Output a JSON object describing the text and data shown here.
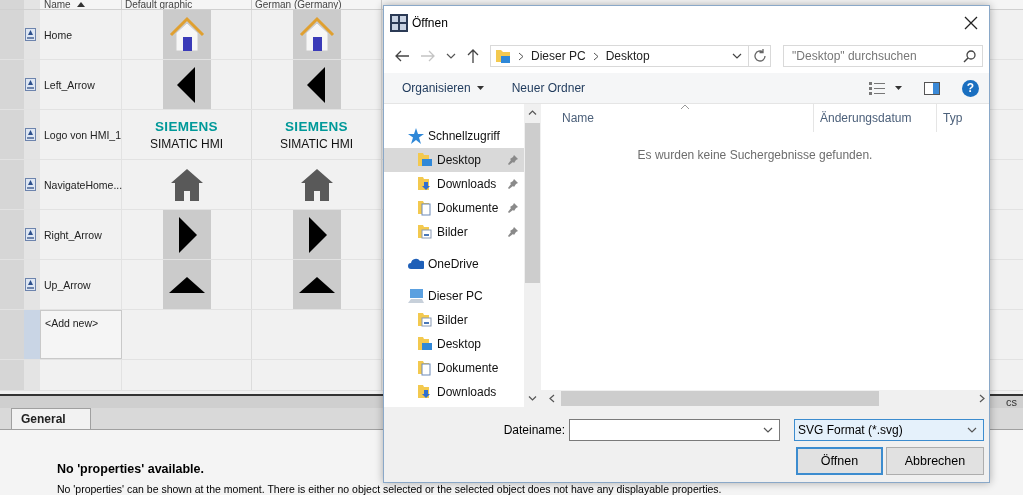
{
  "graphics_table": {
    "columns": [
      {
        "label": "Name",
        "sorted": true
      },
      {
        "label": "Default graphic"
      },
      {
        "label": "German (Germany)"
      }
    ],
    "rows": [
      {
        "cells": [
          {
            "kind": "name",
            "text": "Home"
          },
          {
            "kind": "house"
          },
          {
            "kind": "house"
          }
        ]
      },
      {
        "cells": [
          {
            "kind": "name",
            "text": "Left_Arrow"
          },
          {
            "kind": "arrow_left"
          },
          {
            "kind": "arrow_left"
          }
        ]
      },
      {
        "cells": [
          {
            "kind": "name",
            "text": "Logo von HMI_1"
          },
          {
            "kind": "logo",
            "brand": "SIEMENS",
            "product": "SIMATIC HMI"
          },
          {
            "kind": "logo",
            "brand": "SIEMENS",
            "product": "SIMATIC HMI"
          }
        ]
      },
      {
        "cells": [
          {
            "kind": "name",
            "text": "NavigateHome..."
          },
          {
            "kind": "house_dark"
          },
          {
            "kind": "house_dark"
          }
        ]
      },
      {
        "cells": [
          {
            "kind": "name",
            "text": "Right_Arrow"
          },
          {
            "kind": "arrow_right"
          },
          {
            "kind": "arrow_right"
          }
        ]
      },
      {
        "cells": [
          {
            "kind": "name",
            "text": "Up_Arrow"
          },
          {
            "kind": "arrow_up"
          },
          {
            "kind": "arrow_up"
          }
        ]
      },
      {
        "cells": [
          {
            "kind": "add_new",
            "text": "<Add new>"
          }
        ]
      }
    ]
  },
  "side_tab_fragment": "cs",
  "properties": {
    "tabs": [
      {
        "label": "General",
        "selected": true
      }
    ],
    "heading": "No 'properties' available.",
    "message": "No 'properties' can be shown at the moment. There is either no object selected or the selected object does not have any displayable properties."
  },
  "dialog": {
    "title": "Öffnen",
    "breadcrumb": [
      "Dieser PC",
      "Desktop"
    ],
    "search": {
      "placeholder": "\"Desktop\" durchsuchen"
    },
    "toolbar": [
      {
        "label": "Organisieren",
        "dropdown": true
      },
      {
        "label": "Neuer Ordner",
        "dropdown": false
      }
    ],
    "help": "?",
    "nav": [
      {
        "label": "Schnellzugriff",
        "kind": "star",
        "selected": false,
        "children": [
          {
            "label": "Desktop",
            "kind": "desktop",
            "selected": true,
            "pinned": true
          },
          {
            "label": "Downloads",
            "kind": "downloads",
            "selected": false,
            "pinned": true
          },
          {
            "label": "Dokumente",
            "kind": "documents",
            "selected": false,
            "pinned": true
          },
          {
            "label": "Bilder",
            "kind": "pictures",
            "selected": false,
            "pinned": true
          }
        ]
      },
      {
        "label": "OneDrive",
        "kind": "cloud",
        "selected": false
      },
      {
        "label": "Dieser PC",
        "kind": "computer",
        "selected": false,
        "children": [
          {
            "label": "Bilder",
            "kind": "pictures",
            "selected": false,
            "pinned": false
          },
          {
            "label": "Desktop",
            "kind": "desktop",
            "selected": false,
            "pinned": false
          },
          {
            "label": "Dokumente",
            "kind": "documents",
            "selected": false,
            "pinned": false
          },
          {
            "label": "Downloads",
            "kind": "downloads",
            "selected": false,
            "pinned": false
          }
        ]
      }
    ],
    "columns": [
      "Name",
      "Änderungsdatum",
      "Typ"
    ],
    "empty_message": "Es wurden keine Suchergebnisse gefunden.",
    "filename_label": "Dateiname:",
    "filter": "SVG Format (*.svg)",
    "buttons": [
      {
        "label": "Öffnen",
        "default": true
      },
      {
        "label": "Abbrechen",
        "default": false
      }
    ]
  }
}
